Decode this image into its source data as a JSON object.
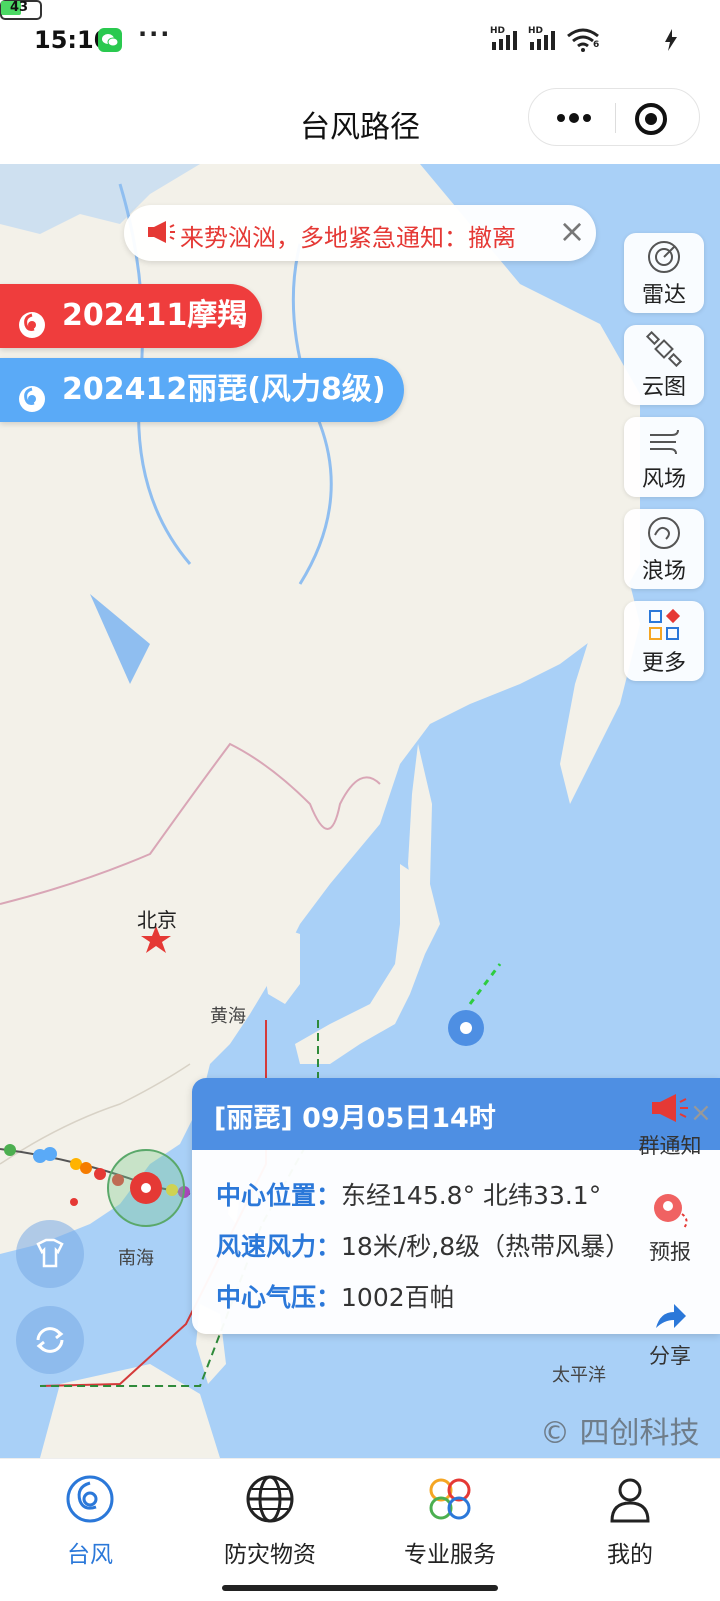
{
  "status_bar": {
    "time": "15:10",
    "more": "···",
    "signal_1": "HD",
    "signal_2": "HD",
    "wifi_badge": "6",
    "battery": "43",
    "icons": [
      "wechat-icon",
      "signal-icon",
      "wifi-icon",
      "battery-icon",
      "charging-icon"
    ]
  },
  "header": {
    "title": "台风路径",
    "capsule": {
      "more_icon": "more-dots-icon",
      "close_icon": "target-circle-icon"
    }
  },
  "notice": {
    "text": "来势汹汹，多地紧急通知：撤离",
    "icon": "megaphone-icon",
    "close_icon": "close-icon"
  },
  "typhoons": [
    {
      "label": "202411摩羯",
      "color": "#ef3d3d"
    },
    {
      "label": "202412丽琵(风力8级)",
      "color": "#5aaaf7"
    }
  ],
  "tools": [
    {
      "label": "雷达",
      "icon": "radar-icon"
    },
    {
      "label": "云图",
      "icon": "satellite-icon"
    },
    {
      "label": "风场",
      "icon": "wind-icon"
    },
    {
      "label": "浪场",
      "icon": "wave-icon"
    },
    {
      "label": "更多",
      "icon": "more-grid-icon"
    }
  ],
  "map_labels": {
    "beijing": "北京",
    "yellow_sea": "黄海",
    "south_sea": "南海",
    "pacific": "太平洋"
  },
  "info_card": {
    "title": "[丽琵] 09月05日14时",
    "rows": [
      {
        "key": "中心位置：",
        "value": "东经145.8°   北纬33.1°"
      },
      {
        "key": "风速风力：",
        "value": "18米/秒,8级（热带风暴）"
      },
      {
        "key": "中心气压：",
        "value": "1002百帕"
      }
    ]
  },
  "side_actions": [
    {
      "label": "群通知",
      "icon": "megaphone-icon"
    },
    {
      "label": "预报",
      "icon": "forecast-pin-icon"
    },
    {
      "label": "分享",
      "icon": "share-arrow-icon"
    }
  ],
  "copyright": "© 四创科技",
  "tab_bar": [
    {
      "label": "台风",
      "icon": "typhoon-icon",
      "active": true,
      "color": "#2b78d9"
    },
    {
      "label": "防灾物资",
      "icon": "globe-icon",
      "active": false
    },
    {
      "label": "专业服务",
      "icon": "clover-icon",
      "active": false
    },
    {
      "label": "我的",
      "icon": "user-icon",
      "active": false
    }
  ]
}
